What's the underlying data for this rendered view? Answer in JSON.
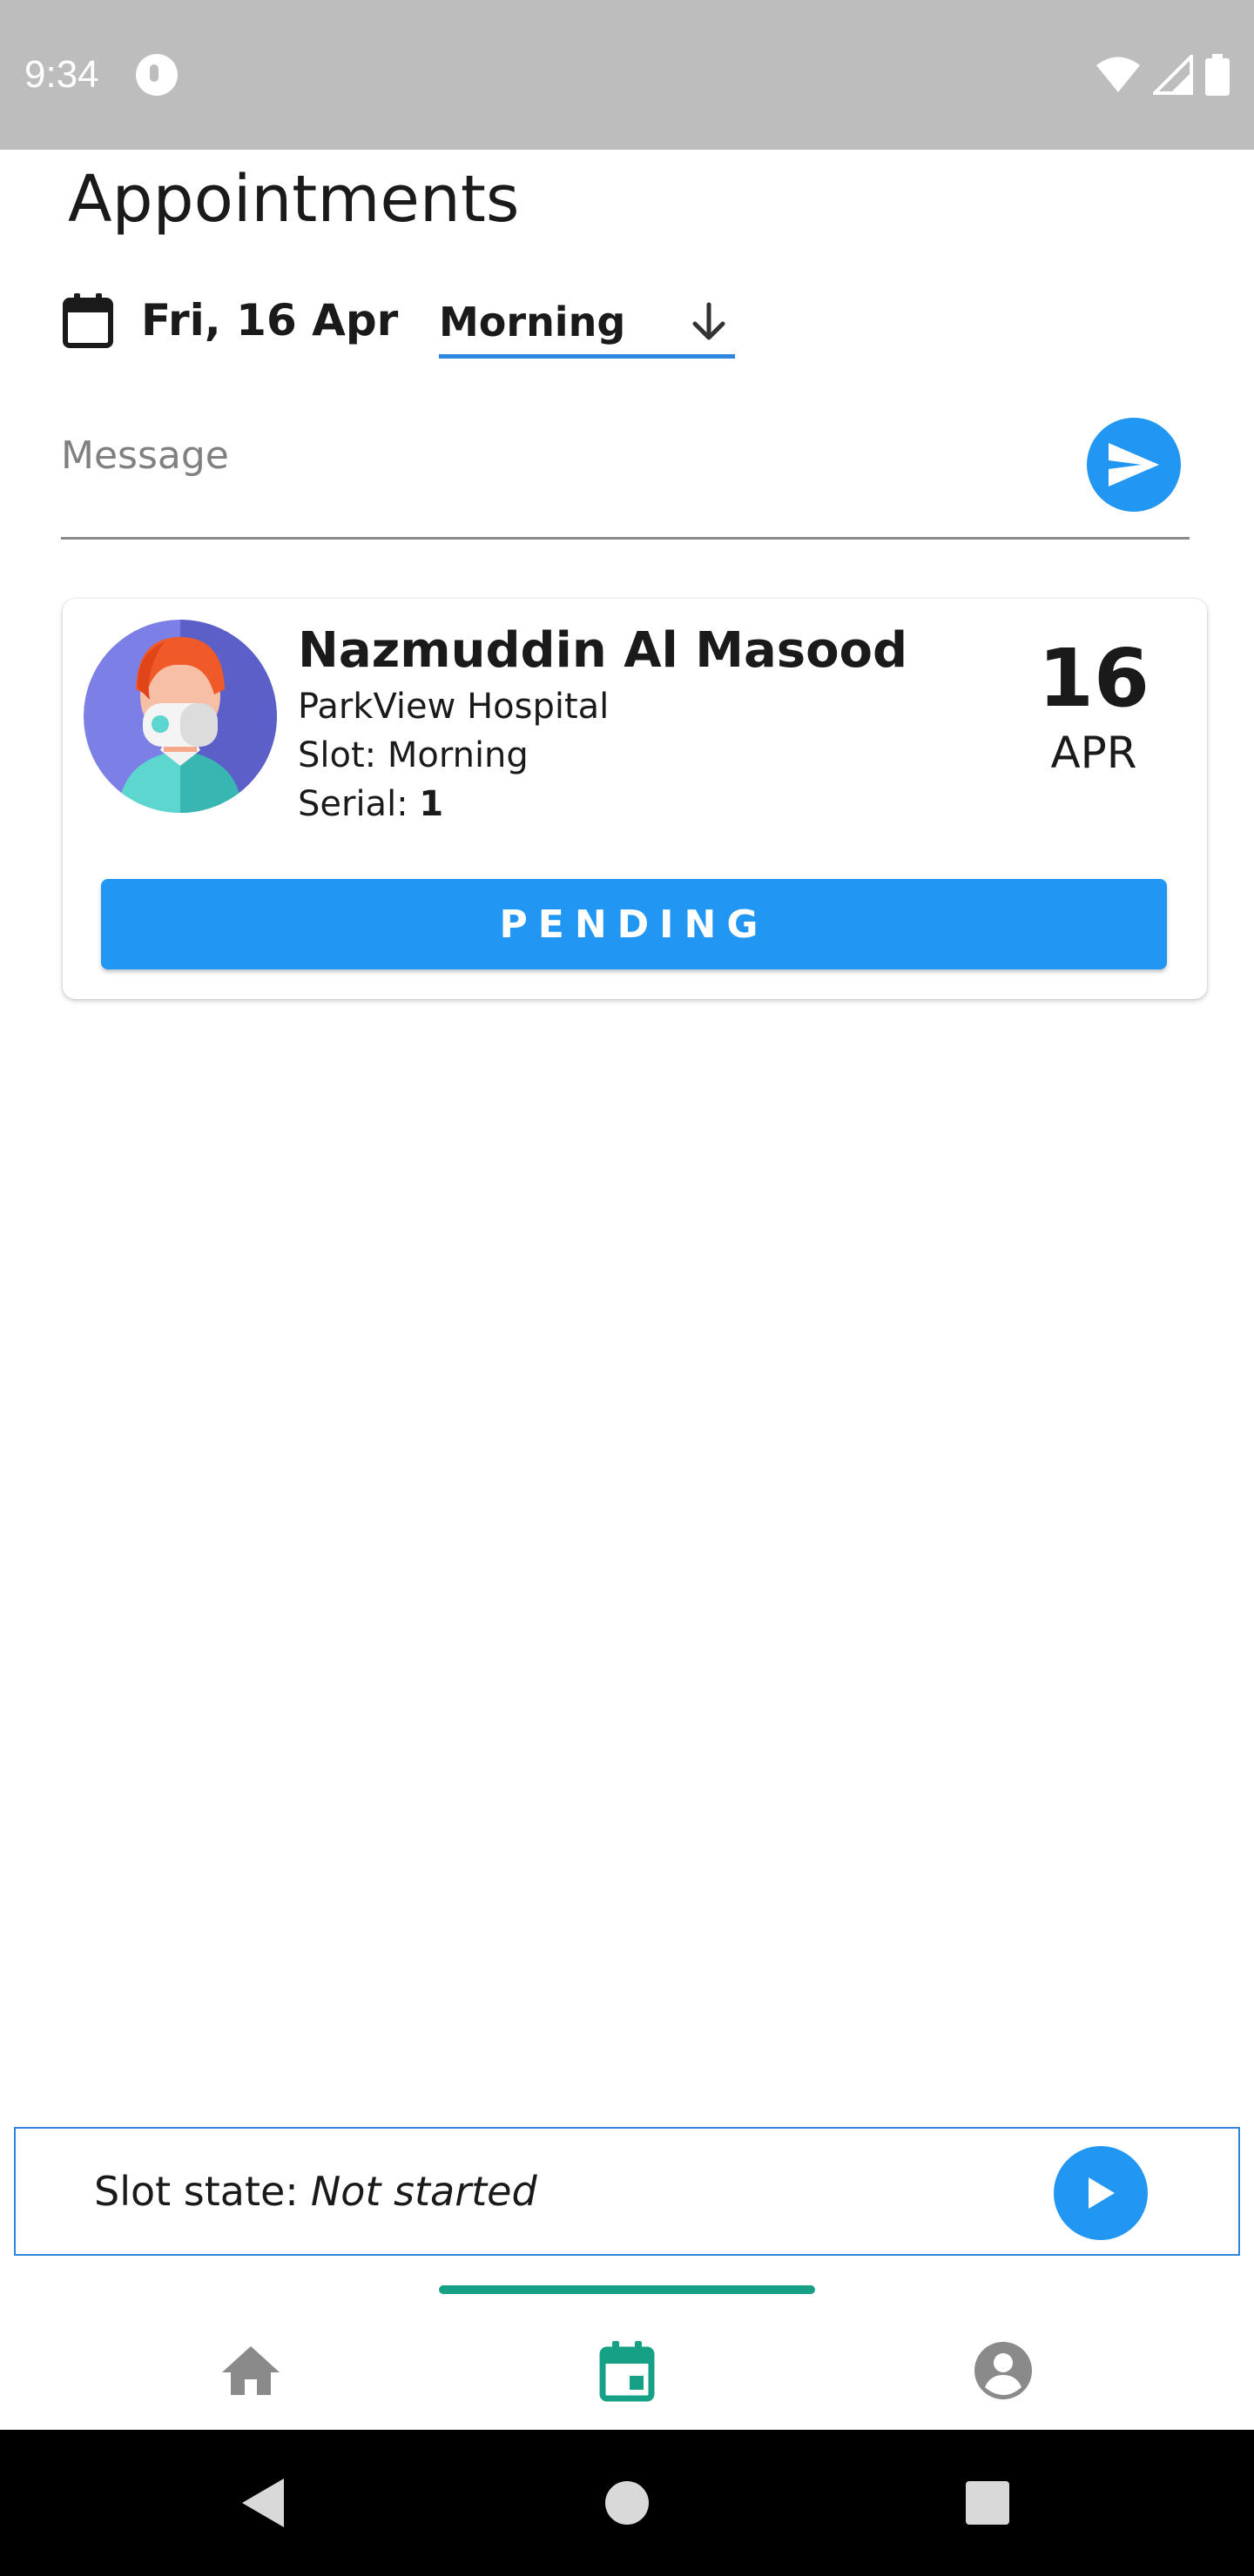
{
  "status_bar": {
    "time": "9:34"
  },
  "header": {
    "title": "Appointments",
    "date_label": "Fri, 16 Apr",
    "slot_value": "Morning"
  },
  "message": {
    "placeholder": "Message"
  },
  "appointment": {
    "name": "Nazmuddin Al Masood",
    "hospital": "ParkView Hospital",
    "slot_label": "Slot:",
    "slot_value": "Morning",
    "serial_label": "Serial:",
    "serial_value": "1",
    "day": "16",
    "month": "APR",
    "status_button": "PENDING"
  },
  "slot_state": {
    "label": "Slot state:",
    "value": "Not started"
  },
  "bottom_nav": {
    "items": [
      {
        "icon": "home-icon",
        "active": false
      },
      {
        "icon": "calendar-icon",
        "active": true
      },
      {
        "icon": "account-icon",
        "active": false
      }
    ]
  },
  "colors": {
    "accent": "#2196f3",
    "nav_active": "#16a085",
    "nav_inactive": "#8a8a8a",
    "status_bar": "#bdbdbd"
  }
}
